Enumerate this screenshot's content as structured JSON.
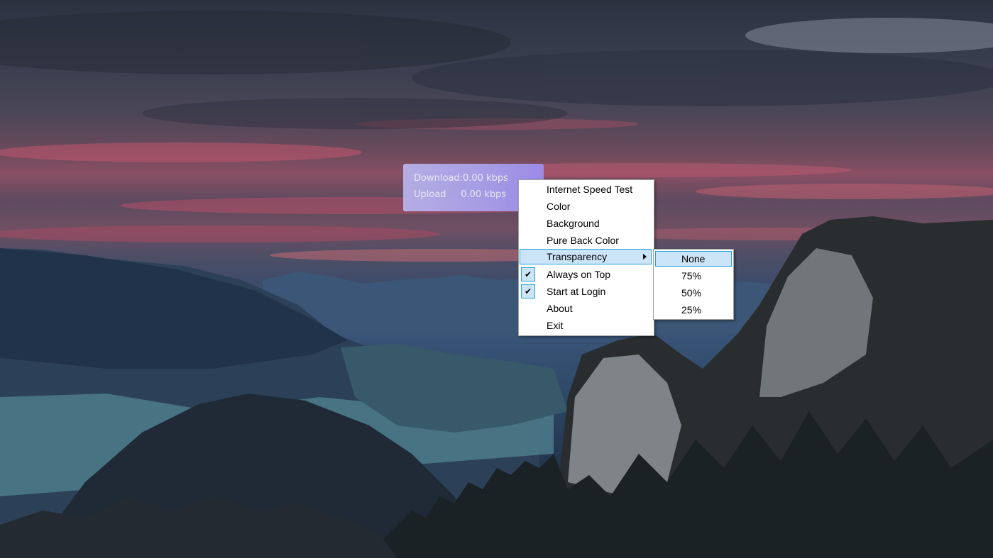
{
  "widget": {
    "download_text": "Download:0.00 kbps",
    "upload_text": "Upload     0.00 kbps"
  },
  "context_menu": {
    "items": [
      {
        "label": "Internet Speed Test",
        "checked": false
      },
      {
        "label": "Color",
        "checked": false
      },
      {
        "label": "Background",
        "checked": false
      },
      {
        "label": "Pure Back Color",
        "checked": false
      },
      {
        "label": "Transparency",
        "checked": false,
        "has_submenu": true,
        "highlighted": true
      },
      {
        "label": "Always on Top",
        "checked": true
      },
      {
        "label": "Start at Login",
        "checked": true
      },
      {
        "label": "About",
        "checked": false
      },
      {
        "label": "Exit",
        "checked": false
      }
    ],
    "check_glyph": "✔"
  },
  "transparency_submenu": {
    "items": [
      {
        "label": "None",
        "highlighted": true
      },
      {
        "label": "75%"
      },
      {
        "label": "50%"
      },
      {
        "label": "25%"
      }
    ]
  },
  "colors": {
    "menu_highlight": "#cce4f7",
    "menu_highlight_border": "#26a0da",
    "widget_bg": "#a9a2f0"
  }
}
